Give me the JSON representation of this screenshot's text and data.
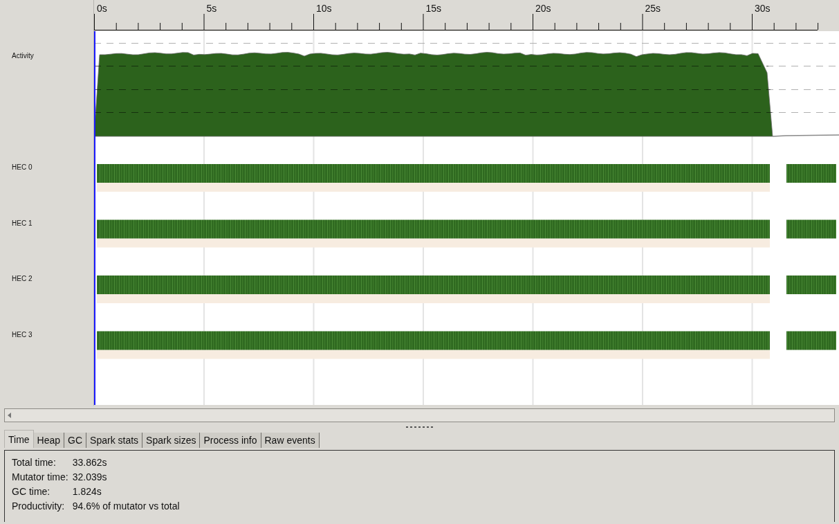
{
  "timeline": {
    "ruler_labels": [
      "0s",
      "5s",
      "10s",
      "15s",
      "20s",
      "25s",
      "30s"
    ],
    "tracks": [
      {
        "kind": "activity",
        "label": "Activity"
      },
      {
        "kind": "hec",
        "label": "HEC 0"
      },
      {
        "kind": "hec",
        "label": "HEC 1"
      },
      {
        "kind": "hec",
        "label": "HEC 2"
      },
      {
        "kind": "hec",
        "label": "HEC 3"
      }
    ]
  },
  "tabs": [
    {
      "label": "Time",
      "selected": true
    },
    {
      "label": "Heap",
      "selected": false
    },
    {
      "label": "GC",
      "selected": false
    },
    {
      "label": "Spark stats",
      "selected": false
    },
    {
      "label": "Spark sizes",
      "selected": false
    },
    {
      "label": "Process info",
      "selected": false
    },
    {
      "label": "Raw events",
      "selected": false
    }
  ],
  "time_summary": [
    {
      "label": "Total time:",
      "value": "33.862s"
    },
    {
      "label": "Mutator time:",
      "value": "32.039s"
    },
    {
      "label": "GC time:",
      "value": "1.824s"
    },
    {
      "label": "Productivity:",
      "value": "94.6% of mutator vs total"
    }
  ]
}
